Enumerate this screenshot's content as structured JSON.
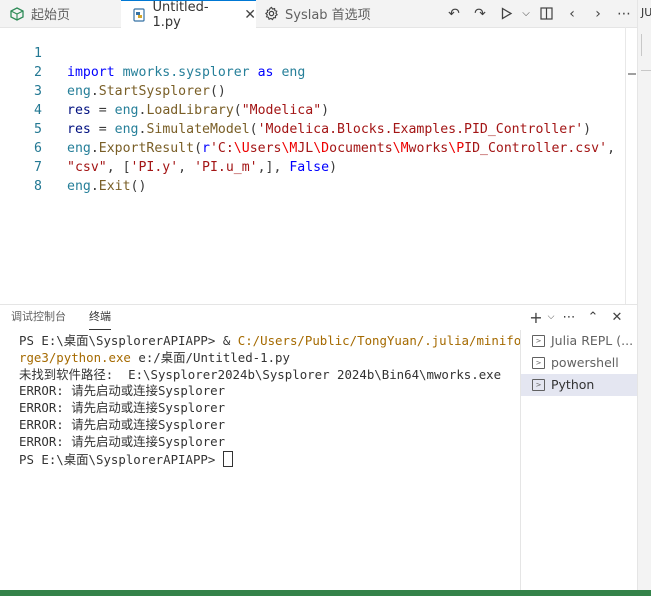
{
  "tabs": [
    {
      "label": "起始页",
      "icon": "start-page-icon"
    },
    {
      "label": "Untitled-1.py",
      "icon": "python-file-icon"
    },
    {
      "label": "Syslab 首选项",
      "icon": "gear-icon"
    }
  ],
  "right_strip": {
    "label": "JU"
  },
  "editor": {
    "line_numbers": [
      "1",
      "2",
      "3",
      "4",
      "5",
      "6",
      "7",
      "8"
    ]
  },
  "panel": {
    "tabs": [
      "调试控制台",
      "终端"
    ]
  },
  "terminal": {
    "line1_prompt": "PS E:\\桌面\\SysplorerAPIAPP> & ",
    "line1_path": "C:/Users/Public/TongYuan/.julia/minifo",
    "line2_path": "rge3/python.exe",
    "line2_rest": " e:/桌面/Untitled-1.py",
    "line3": "未找到软件路径:  E:\\Sysplorer2024b\\Sysplorer 2024b\\Bin64\\mworks.exe",
    "errors": [
      "ERROR: 请先启动或连接Sysplorer",
      "ERROR: 请先启动或连接Sysplorer",
      "ERROR: 请先启动或连接Sysplorer",
      "ERROR: 请先启动或连接Sysplorer"
    ],
    "last_prompt": "PS E:\\桌面\\SysplorerAPIAPP> "
  },
  "terminal_list": [
    {
      "label": "Julia REPL (..."
    },
    {
      "label": "powershell"
    },
    {
      "label": "Python",
      "selected": true
    }
  ],
  "colors": {
    "accent": "#0078d4",
    "status_bar": "#34834a"
  }
}
